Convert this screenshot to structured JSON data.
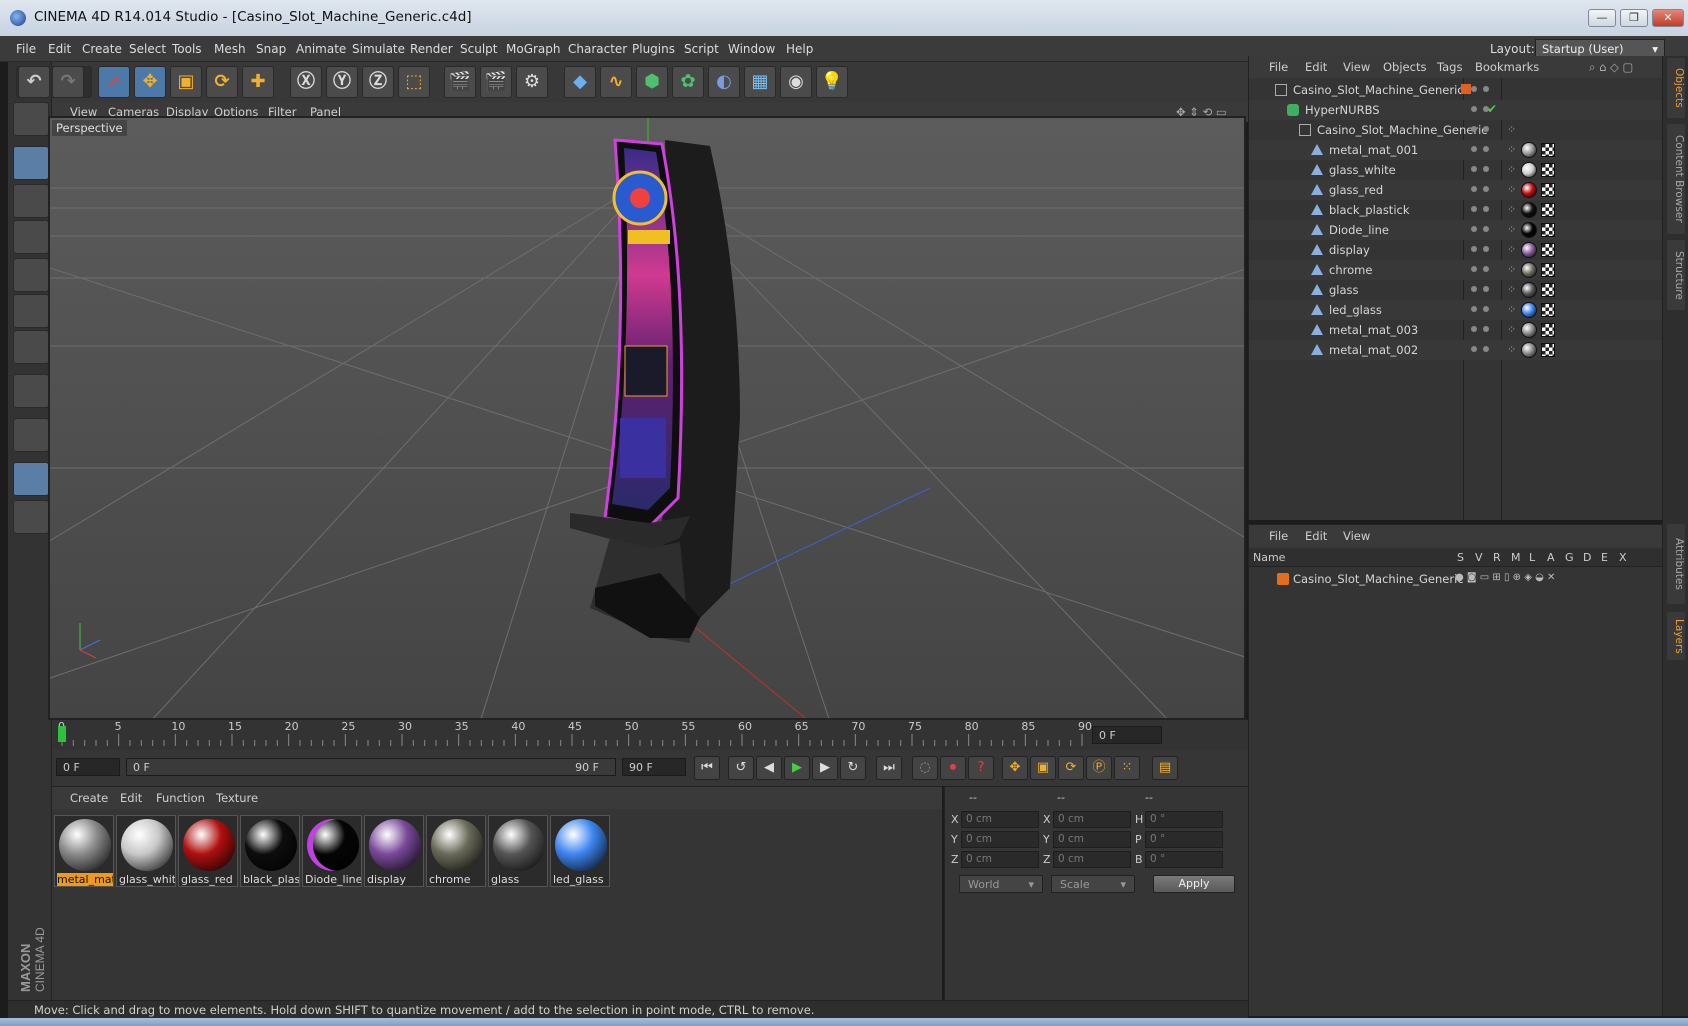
{
  "window": {
    "title": "CINEMA 4D R14.014 Studio - [Casino_Slot_Machine_Generic.c4d]"
  },
  "menubar": {
    "items": [
      "File",
      "Edit",
      "Create",
      "Select",
      "Tools",
      "Mesh",
      "Snap",
      "Animate",
      "Simulate",
      "Render",
      "Sculpt",
      "MoGraph",
      "Character",
      "Plugins",
      "Script",
      "Window",
      "Help"
    ],
    "layout_label": "Layout:",
    "layout_value": "Startup (User)"
  },
  "viewport": {
    "menu": [
      "View",
      "Cameras",
      "Display",
      "Options",
      "Filter",
      "Panel"
    ],
    "label": "Perspective"
  },
  "timeline": {
    "ticks": [
      "0",
      "5",
      "10",
      "15",
      "20",
      "25",
      "30",
      "35",
      "40",
      "45",
      "50",
      "55",
      "60",
      "65",
      "70",
      "75",
      "80",
      "85",
      "90"
    ],
    "current_frame": "0 F",
    "start_field": "0 F",
    "range_start": "0 F",
    "range_end": "90 F",
    "end_field": "90 F"
  },
  "materials": {
    "menu": [
      "Create",
      "Edit",
      "Function",
      "Texture"
    ],
    "items": [
      {
        "label": "metal_mat",
        "color": "#8a8a8a",
        "selected": true
      },
      {
        "label": "glass_whit",
        "color": "#c8c8c8",
        "selected": false
      },
      {
        "label": "glass_red",
        "color": "#b01010",
        "selected": false
      },
      {
        "label": "black_plast",
        "color": "#0d0d0d",
        "selected": false
      },
      {
        "label": "Diode_line",
        "color": "#050505",
        "selected": false
      },
      {
        "label": "display",
        "color": "#7a4a9a",
        "selected": false
      },
      {
        "label": "chrome",
        "color": "#6a6a5a",
        "selected": false
      },
      {
        "label": "glass",
        "color": "#555555",
        "selected": false
      },
      {
        "label": "led_glass",
        "color": "#3d86f0",
        "selected": false
      }
    ]
  },
  "coordinates": {
    "headers": [
      "--",
      "--",
      "--"
    ],
    "rows": [
      {
        "a": "X",
        "av": "0 cm",
        "b": "X",
        "bv": "0 cm",
        "c": "H",
        "cv": "0 °"
      },
      {
        "a": "Y",
        "av": "0 cm",
        "b": "Y",
        "bv": "0 cm",
        "c": "P",
        "cv": "0 °"
      },
      {
        "a": "Z",
        "av": "0 cm",
        "b": "Z",
        "bv": "0 cm",
        "c": "B",
        "cv": "0 °"
      }
    ],
    "mode_select": "World",
    "size_select": "Scale",
    "apply_label": "Apply"
  },
  "objects": {
    "menu": [
      "File",
      "Edit",
      "View",
      "Objects",
      "Tags",
      "Bookmarks"
    ],
    "tree": [
      {
        "name": "Casino_Slot_Machine_Generic",
        "level": 0,
        "icon": "null-icon"
      },
      {
        "name": "HyperNURBS",
        "level": 1,
        "icon": "hypernurbs-icon"
      },
      {
        "name": "Casino_Slot_Machine_Generic",
        "level": 2,
        "icon": "null-icon"
      },
      {
        "name": "metal_mat_001",
        "level": 3,
        "icon": "polygon-icon",
        "tag": "#9a9a9a"
      },
      {
        "name": "glass_white",
        "level": 3,
        "icon": "polygon-icon",
        "tag": "#d0d0d0"
      },
      {
        "name": "glass_red",
        "level": 3,
        "icon": "polygon-icon",
        "tag": "#c01010"
      },
      {
        "name": "black_plastick",
        "level": 3,
        "icon": "polygon-icon",
        "tag": "#101010"
      },
      {
        "name": "Diode_line",
        "level": 3,
        "icon": "polygon-icon",
        "tag": "#050505"
      },
      {
        "name": "display",
        "level": 3,
        "icon": "polygon-icon",
        "tag": "#8a5aa0"
      },
      {
        "name": "chrome",
        "level": 3,
        "icon": "polygon-icon",
        "tag": "#707060"
      },
      {
        "name": "glass",
        "level": 3,
        "icon": "polygon-icon",
        "tag": "#5a5a5a"
      },
      {
        "name": "led_glass",
        "level": 3,
        "icon": "polygon-icon",
        "tag": "#3d86f0"
      },
      {
        "name": "metal_mat_003",
        "level": 3,
        "icon": "polygon-icon",
        "tag": "#8a8a8a"
      },
      {
        "name": "metal_mat_002",
        "level": 3,
        "icon": "polygon-icon",
        "tag": "#8a8a8a"
      }
    ]
  },
  "layers": {
    "menu": [
      "File",
      "Edit",
      "View"
    ],
    "columns": [
      "Name",
      "S",
      "V",
      "R",
      "M",
      "L",
      "A",
      "G",
      "D",
      "E",
      "X"
    ],
    "rows": [
      {
        "name": "Casino_Slot_Machine_Generic"
      }
    ]
  },
  "side_tabs": [
    "Objects",
    "Content Browser",
    "Structure",
    "Attributes",
    "Layers"
  ],
  "status": {
    "text": "Move: Click and drag to move elements. Hold down SHIFT to quantize movement / add to the selection in point mode, CTRL to remove."
  },
  "branding": {
    "logo": "MAXON CINEMA 4D"
  },
  "colors": {
    "accent": "#f09a1c",
    "selection": "#5a7ea6"
  }
}
